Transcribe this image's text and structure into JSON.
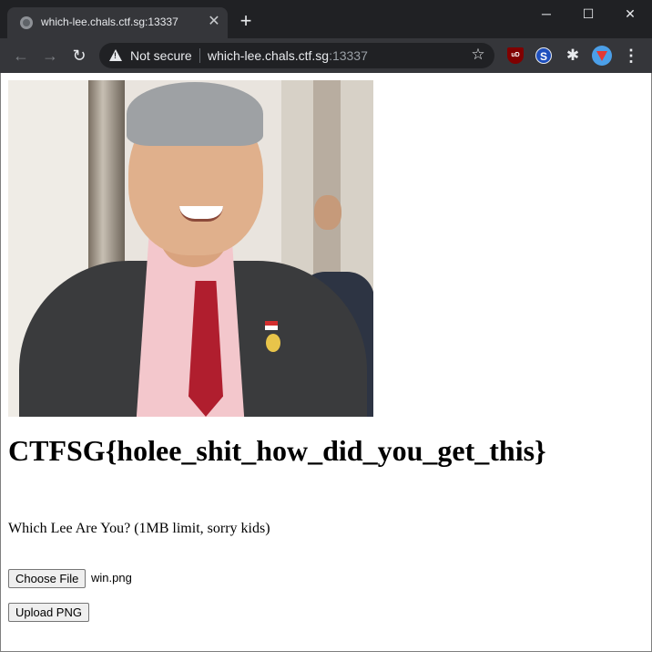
{
  "browser": {
    "tab": {
      "title": "which-lee.chals.ctf.sg:13337",
      "favicon": "globe-icon"
    },
    "new_tab_icon": "plus-icon",
    "window_controls": {
      "minimize": "─",
      "maximize": "☐",
      "close": "✕"
    },
    "nav": {
      "back": "←",
      "forward": "→",
      "reload": "↻"
    },
    "omnibox": {
      "security_label": "Not secure",
      "url_host": "which-lee.chals.ctf.sg",
      "url_port": ":13337",
      "bookmark_icon": "☆"
    },
    "extensions": {
      "ublock": "uD",
      "s": "S",
      "puzzle": "✱",
      "menu": "⋮"
    },
    "colors": {
      "tabstrip": "#202124",
      "toolbar": "#35363a",
      "omnibox": "#202124"
    }
  },
  "page": {
    "photo": {
      "subject": "man-in-suit-smiling"
    },
    "flag": "CTFSG{holee_shit_how_did_you_get_this}",
    "prompt": "Which Lee Are You? (1MB limit, sorry kids)",
    "choose_file_label": "Choose File",
    "selected_file": "win.png",
    "upload_label": "Upload PNG"
  }
}
